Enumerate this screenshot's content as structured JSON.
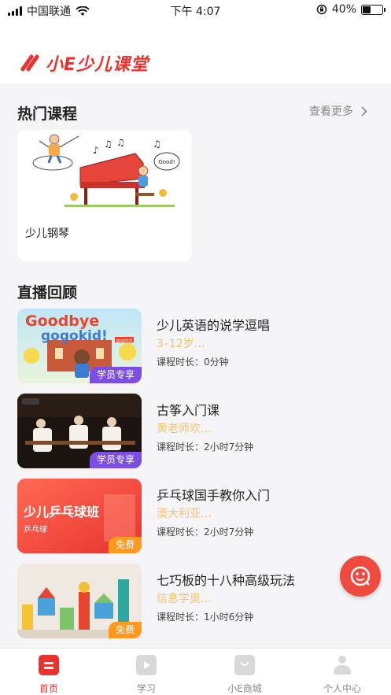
{
  "status_bar": {
    "carrier": "中国联通",
    "time": "下午 4:07",
    "battery": "40%",
    "battery_level": 0.4
  },
  "header": {
    "app_name": "小E少儿课堂"
  },
  "hot_courses": {
    "title": "热门课程",
    "more": "查看更多",
    "items": [
      {
        "name": "少儿钢琴",
        "bubble": "Good!"
      }
    ]
  },
  "live_replay": {
    "title": "直播回顾",
    "items": [
      {
        "title": "少儿英语的说学逗唱",
        "teacher": "3–12岁…",
        "duration_label": "课程时长：",
        "duration": "0分钟",
        "badge": "学员专享",
        "thumb_text1": "Goodbye",
        "thumb_text2": "gogokid!",
        "thumb_small": "gogokid"
      },
      {
        "title": "古筝入门课",
        "teacher": "黄老师欢…",
        "duration_label": "课程时长：",
        "duration": "2小时7分钟",
        "badge": "学员专享"
      },
      {
        "title": "乒乓球国手教你入门",
        "teacher": "澳大利亚…",
        "duration_label": "课程时长：",
        "duration": "2小时7分钟",
        "badge": "免费",
        "thumb_text1": "少儿乒乓球班",
        "thumb_text2": "乒乓球"
      },
      {
        "title": "七巧板的十八种高级玩法",
        "teacher": "信息学奥…",
        "duration_label": "课程时长：",
        "duration": "1小时6分钟",
        "badge": "免费"
      }
    ]
  },
  "tabs": [
    {
      "label": "首页",
      "icon": "home-icon"
    },
    {
      "label": "学习",
      "icon": "tv-icon"
    },
    {
      "label": "小E商城",
      "icon": "shop-bag-icon"
    },
    {
      "label": "个人中心",
      "icon": "person-icon"
    }
  ],
  "colors": {
    "brand": "#e8332e",
    "badge_purple": "#7c4ee4",
    "badge_orange": "#ff9a1e",
    "teacher_text": "#f3c36b"
  }
}
